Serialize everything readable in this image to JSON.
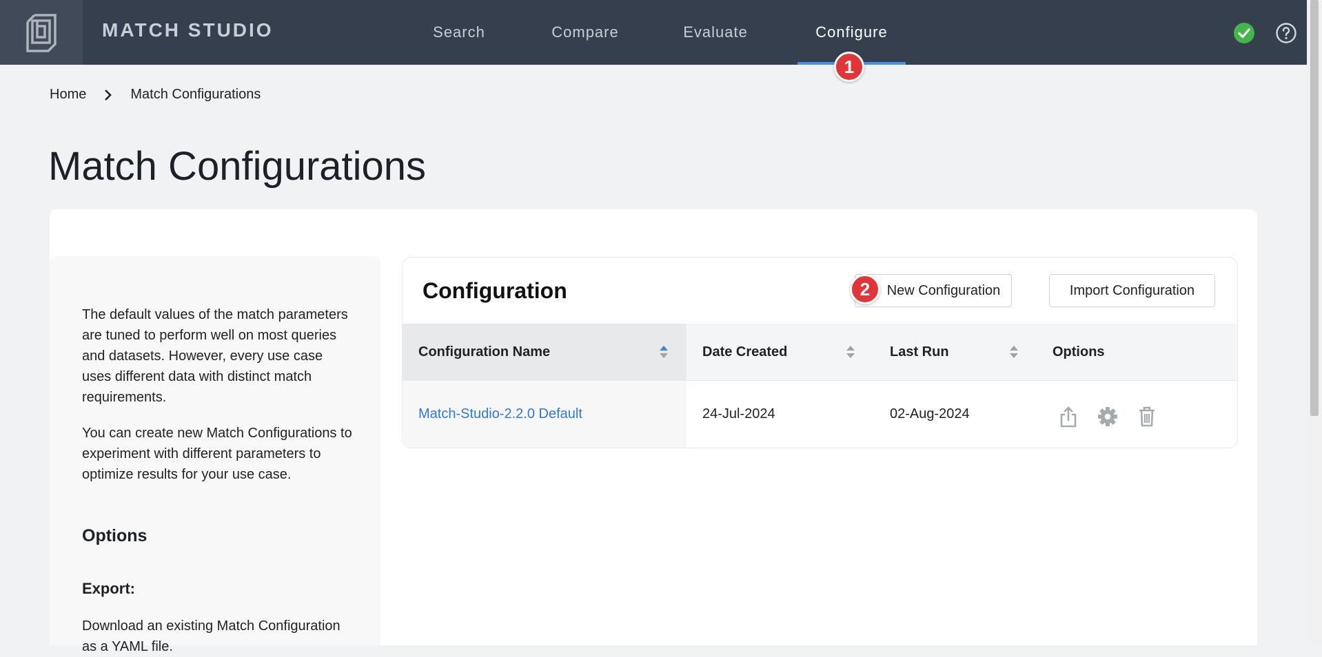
{
  "app": {
    "brand": "MATCH STUDIO"
  },
  "nav": {
    "items": [
      {
        "label": "Search"
      },
      {
        "label": "Compare"
      },
      {
        "label": "Evaluate"
      },
      {
        "label": "Configure",
        "active": true
      }
    ],
    "step_badge": "1"
  },
  "breadcrumb": {
    "home": "Home",
    "current": "Match Configurations"
  },
  "page": {
    "title": "Match Configurations"
  },
  "sidebar": {
    "para1": "The default values of the match parameters are tuned to perform well on most queries and datasets. However, every use case uses different data with distinct match requirements.",
    "para2": "You can create new Match Configurations to experiment with different parameters to optimize results for your use case.",
    "options_heading": "Options",
    "export_heading": "Export:",
    "export_text": "Download an existing Match Configuration as a YAML file."
  },
  "configuration": {
    "title": "Configuration",
    "new_button": "New Configuration",
    "new_badge": "2",
    "import_button": "Import Configuration",
    "columns": {
      "name": "Configuration Name",
      "date_created": "Date Created",
      "last_run": "Last Run",
      "options": "Options"
    },
    "rows": [
      {
        "name": "Match-Studio-2.2.0 Default",
        "date_created": "24-Jul-2024",
        "last_run": "02-Aug-2024"
      }
    ]
  },
  "colors": {
    "topbar": "#363f4e",
    "accent": "#4a8fe0",
    "link": "#2f78d8",
    "status_ok": "#43b54a",
    "badge": "#e0363a"
  },
  "icons": {
    "logo": "logo-icon",
    "status": "check-circle-icon",
    "help": "help-circle-icon",
    "row_options": [
      "export-icon",
      "settings-gear-icon",
      "trash-icon"
    ]
  }
}
